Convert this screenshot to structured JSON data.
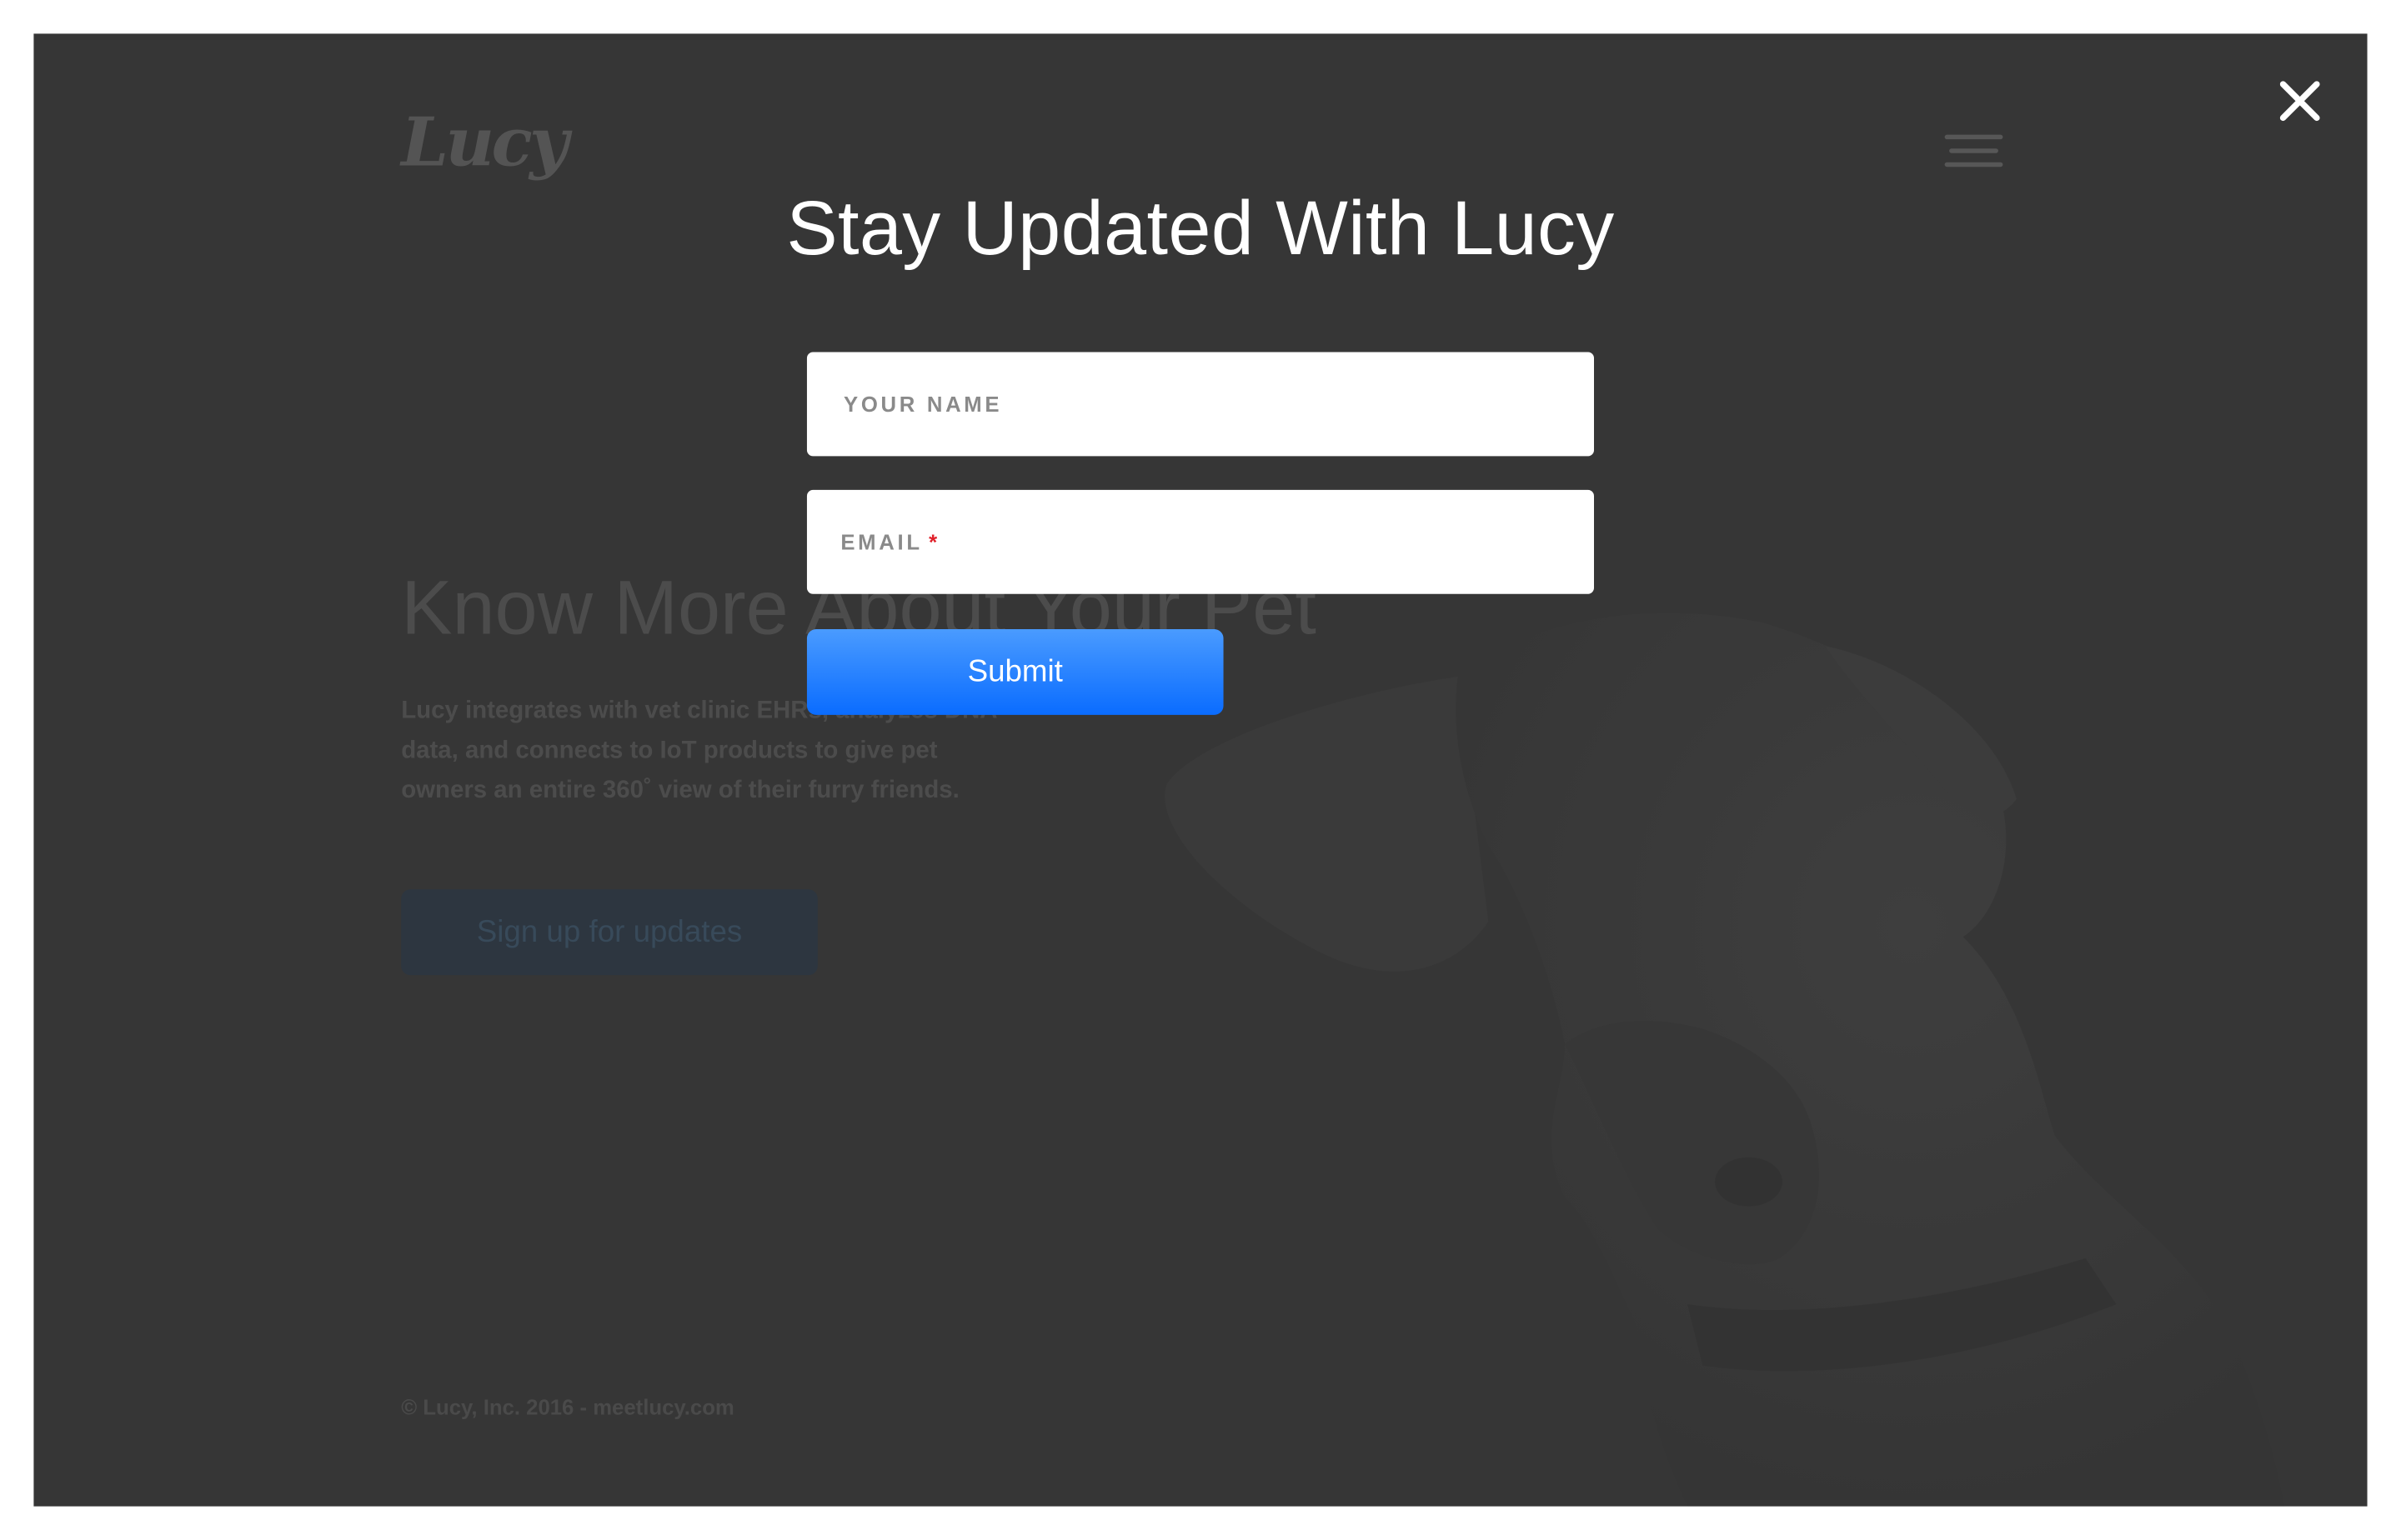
{
  "background_page": {
    "logo_text": "Lucy",
    "hero_title": "Know More About Your Pet",
    "hero_text": "Lucy integrates with vet clinic EHRs, analyzes DNA data, and connects to IoT products to give pet owners an entire 360˚ view of their furry friends.",
    "signup_button_label": "Sign up for updates",
    "copyright": "© Lucy, Inc. 2016 - meetlucy.com"
  },
  "modal": {
    "title": "Stay Updated With Lucy",
    "name_placeholder": "YOUR NAME",
    "email_label": "EMAIL",
    "email_required_mark": "*",
    "submit_label": "Submit"
  },
  "colors": {
    "page_background": "#3a3a3a",
    "submit_gradient_top": "#4a9bff",
    "submit_gradient_bottom": "#0a6cff",
    "required_mark": "#e0202a"
  },
  "icons": {
    "close": "close-icon",
    "menu": "hamburger-menu-icon"
  }
}
